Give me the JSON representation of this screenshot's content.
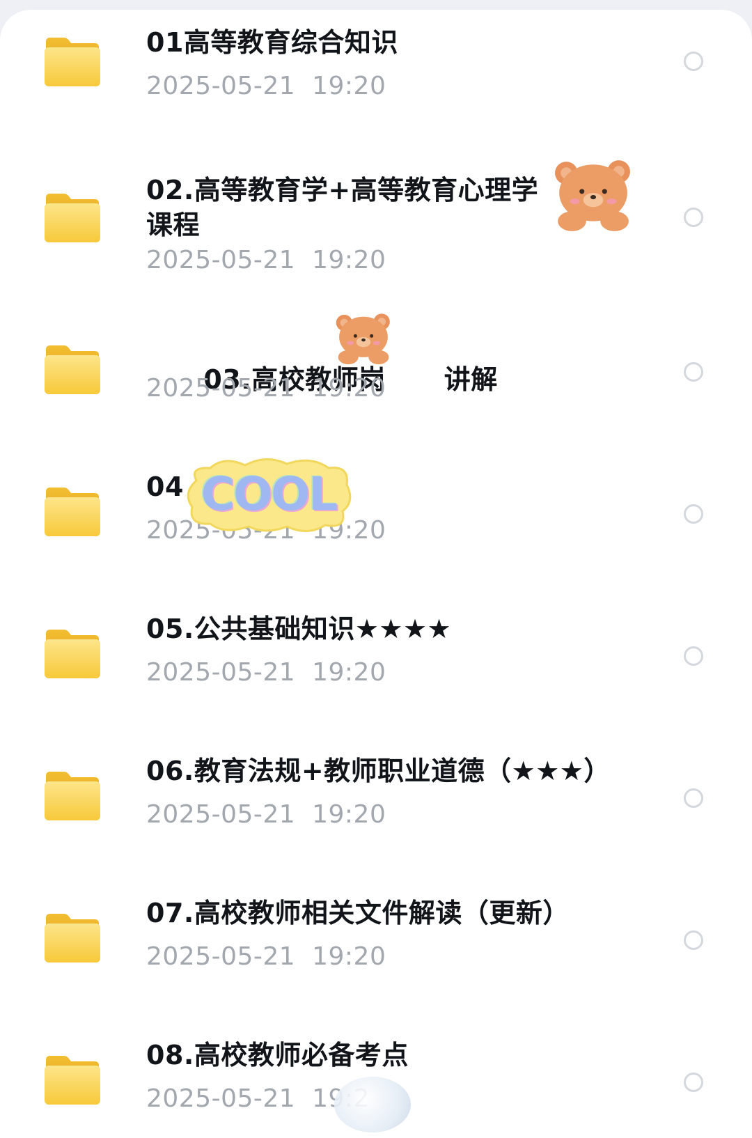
{
  "files": [
    {
      "name": "01高等教育综合知识",
      "modified": "2025-05-21  19:20"
    },
    {
      "name": "02.高等教育学+高等教育心理学\n课程",
      "modified": "2025-05-21  19:20"
    },
    {
      "name": "03.高校教师岗",
      "name_end": "讲解",
      "modified": "2025-05-21  19:20"
    },
    {
      "name": "04",
      "modified": "2025-05-21  19:20"
    },
    {
      "name": "05.公共基础知识★★★★",
      "modified": "2025-05-21  19:20"
    },
    {
      "name": "06.教育法规+教师职业道德（★★★）",
      "modified": "2025-05-21  19:20"
    },
    {
      "name": "07.高校教师相关文件解读（更新）",
      "modified": "2025-05-21  19:20"
    },
    {
      "name": "08.高校教师必备考点",
      "modified": "2025-05-21  19:2"
    }
  ],
  "stickers": {
    "cool_text": "COOL"
  },
  "icons": {
    "folder": "folder-icon",
    "select": "radio-circle-icon",
    "sticker_bear": "bear-sticker-icon"
  },
  "colors": {
    "folder_yellow": "#f9cf43",
    "title_text": "#111418",
    "time_text": "#a3a7ae"
  }
}
